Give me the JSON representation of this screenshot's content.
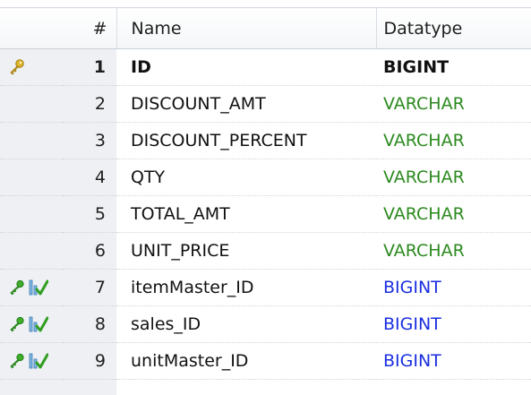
{
  "columns": {
    "number": "#",
    "name": "Name",
    "datatype": "Datatype"
  },
  "rows": [
    {
      "num": "1",
      "name": "ID",
      "type": "BIGINT",
      "type_color": "#111111",
      "icon": "primary-key-icon"
    },
    {
      "num": "2",
      "name": "DISCOUNT_AMT",
      "type": "VARCHAR",
      "type_color": "#2c8a1f",
      "icon": ""
    },
    {
      "num": "3",
      "name": "DISCOUNT_PERCENT",
      "type": "VARCHAR",
      "type_color": "#2c8a1f",
      "icon": ""
    },
    {
      "num": "4",
      "name": "QTY",
      "type": "VARCHAR",
      "type_color": "#2c8a1f",
      "icon": ""
    },
    {
      "num": "5",
      "name": "TOTAL_AMT",
      "type": "VARCHAR",
      "type_color": "#2c8a1f",
      "icon": ""
    },
    {
      "num": "6",
      "name": "UNIT_PRICE",
      "type": "VARCHAR",
      "type_color": "#2c8a1f",
      "icon": ""
    },
    {
      "num": "7",
      "name": "itemMaster_ID",
      "type": "BIGINT",
      "type_color": "#1a2ee0",
      "icon": "foreign-key-index-icon"
    },
    {
      "num": "8",
      "name": "sales_ID",
      "type": "BIGINT",
      "type_color": "#1a2ee0",
      "icon": "foreign-key-index-icon"
    },
    {
      "num": "9",
      "name": "unitMaster_ID",
      "type": "BIGINT",
      "type_color": "#1a2ee0",
      "icon": "foreign-key-index-icon"
    }
  ]
}
